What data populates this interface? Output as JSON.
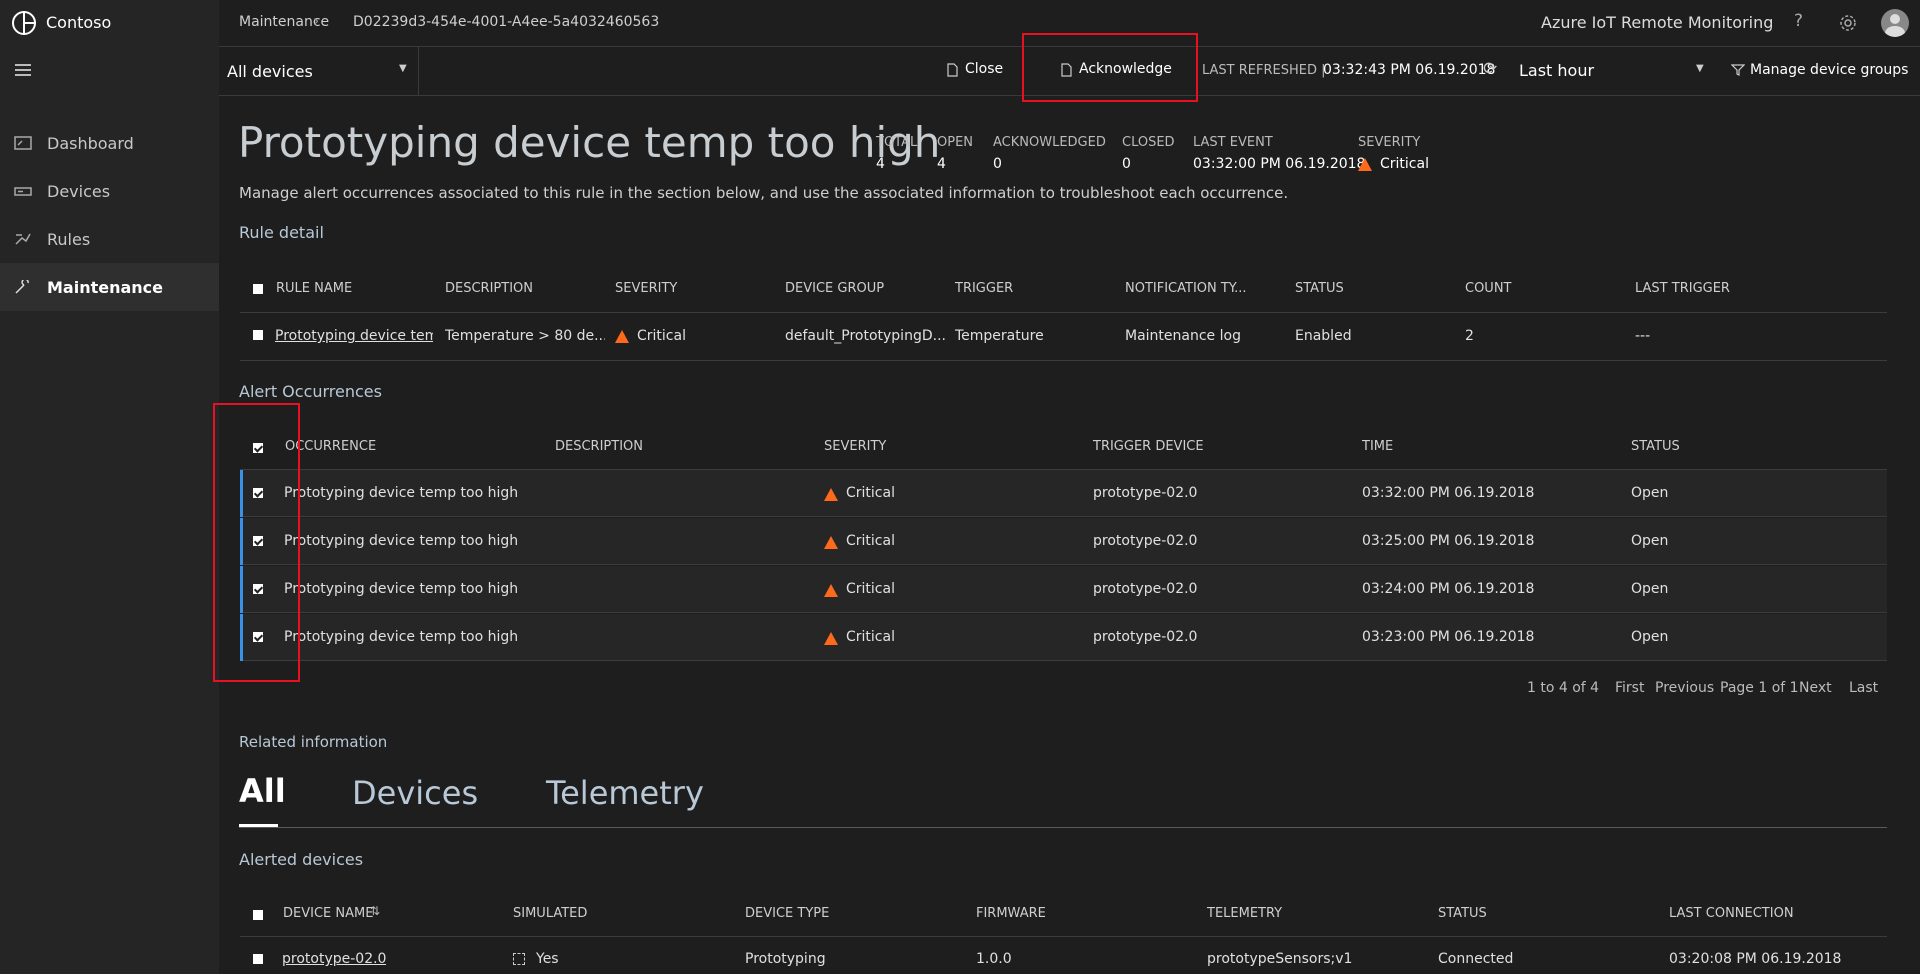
{
  "app": {
    "name": "Contoso",
    "title": "Azure IoT Remote Monitoring"
  },
  "breadcrumb": {
    "parent": "Maintenance",
    "current": "D02239d3-454e-4001-A4ee-5a4032460563"
  },
  "sidebar": {
    "items": [
      {
        "label": "Dashboard",
        "icon": "dashboard-icon"
      },
      {
        "label": "Devices",
        "icon": "devices-icon"
      },
      {
        "label": "Rules",
        "icon": "rules-icon"
      },
      {
        "label": "Maintenance",
        "icon": "maintenance-icon",
        "active": true
      }
    ]
  },
  "context": {
    "device_filter": "All devices",
    "close_label": "Close",
    "acknowledge_label": "Acknowledge",
    "last_refreshed_label": "LAST REFRESHED |",
    "last_refreshed_value": "03:32:43 PM 06.19.2018",
    "time_range": "Last hour",
    "manage_groups_label": "Manage device groups"
  },
  "summary": {
    "title": "Prototyping device temp too high",
    "stats": [
      {
        "label": "TOTAL",
        "value": "4"
      },
      {
        "label": "OPEN",
        "value": "4"
      },
      {
        "label": "ACKNOWLEDGED",
        "value": "0"
      },
      {
        "label": "CLOSED",
        "value": "0"
      },
      {
        "label": "LAST EVENT",
        "value": "03:32:00 PM 06.19.2018"
      },
      {
        "label": "SEVERITY",
        "value": "Critical"
      }
    ],
    "description": "Manage alert occurrences associated to this rule in the section below, and use the associated information to troubleshoot each occurrence."
  },
  "rule_detail": {
    "heading": "Rule detail",
    "columns": [
      "RULE NAME",
      "DESCRIPTION",
      "SEVERITY",
      "DEVICE GROUP",
      "TRIGGER",
      "NOTIFICATION TY...",
      "STATUS",
      "COUNT",
      "LAST TRIGGER"
    ],
    "row": {
      "rule_name": "Prototyping device temp t",
      "description": "Temperature > 80 de...",
      "severity": "Critical",
      "device_group": "default_PrototypingD...",
      "trigger": "Temperature",
      "notification": "Maintenance log",
      "status": "Enabled",
      "count": "2",
      "last_trigger": "---"
    }
  },
  "occurrences": {
    "heading": "Alert Occurrences",
    "columns": [
      "OCCURRENCE",
      "DESCRIPTION",
      "SEVERITY",
      "TRIGGER DEVICE",
      "TIME",
      "STATUS"
    ],
    "rows": [
      {
        "occurrence": "Prototyping device temp too high",
        "description": "",
        "severity": "Critical",
        "device": "prototype-02.0",
        "time": "03:32:00 PM 06.19.2018",
        "status": "Open"
      },
      {
        "occurrence": "Prototyping device temp too high",
        "description": "",
        "severity": "Critical",
        "device": "prototype-02.0",
        "time": "03:25:00 PM 06.19.2018",
        "status": "Open"
      },
      {
        "occurrence": "Prototyping device temp too high",
        "description": "",
        "severity": "Critical",
        "device": "prototype-02.0",
        "time": "03:24:00 PM 06.19.2018",
        "status": "Open"
      },
      {
        "occurrence": "Prototyping device temp too high",
        "description": "",
        "severity": "Critical",
        "device": "prototype-02.0",
        "time": "03:23:00 PM 06.19.2018",
        "status": "Open"
      }
    ],
    "pagination": {
      "range": "1 to 4 of 4",
      "first": "First",
      "previous": "Previous",
      "page": "Page 1 of 1",
      "next": "Next",
      "last": "Last"
    }
  },
  "related": {
    "heading": "Related information",
    "tabs": [
      "All",
      "Devices",
      "Telemetry"
    ],
    "alerted_heading": "Alerted devices",
    "columns": [
      "DEVICE NAME",
      "SIMULATED",
      "DEVICE TYPE",
      "FIRMWARE",
      "TELEMETRY",
      "STATUS",
      "LAST CONNECTION"
    ],
    "row": {
      "name": "prototype-02.0",
      "simulated": "Yes",
      "type": "Prototyping",
      "firmware": "1.0.0",
      "telemetry": "prototypeSensors;v1",
      "status": "Connected",
      "last_connection": "03:20:08 PM 06.19.2018"
    }
  },
  "colors": {
    "accent": "#3a92e8",
    "critical": "#ff6a1a",
    "highlight": "#e81123"
  }
}
